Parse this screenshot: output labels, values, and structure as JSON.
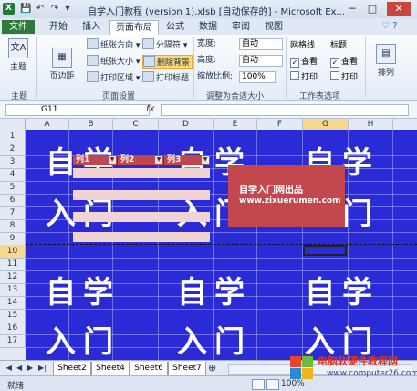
{
  "window": {
    "title": "自学入门教程 (version 1).xlsb [自动保存的] - Microsoft Ex...",
    "minimize": "─",
    "maximize": "□",
    "close": "✕"
  },
  "qat": {
    "save": "💾",
    "undo": "↶",
    "redo": "↷",
    "more": "▾"
  },
  "tabs": {
    "file": "文件",
    "items": [
      "开始",
      "插入",
      "页面布局",
      "公式",
      "数据",
      "审阅",
      "视图"
    ],
    "active_index": 2,
    "help": "♡ ?"
  },
  "ribbon": {
    "theme": {
      "icon": "文A",
      "label": "主题",
      "group": "主题"
    },
    "margins": {
      "label": "页边距"
    },
    "page_setup": {
      "orientation": "纸张方向 ▾",
      "size": "纸张大小 ▾",
      "print_area": "打印区域 ▾",
      "breaks": "分隔符 ▾",
      "delete_bg": "删除背景",
      "print_titles": "打印标题",
      "group": "页面设置"
    },
    "scale": {
      "width_label": "宽度:",
      "width_value": "自动",
      "height_label": "高度:",
      "height_value": "自动",
      "scale_label": "缩放比例:",
      "scale_value": "100%",
      "group": "调整为合适大小"
    },
    "sheet_options": {
      "gridlines": "网格线",
      "headings": "标题",
      "view": "查看",
      "print": "打印",
      "group": "工作表选项"
    },
    "arrange": {
      "label": "排列"
    }
  },
  "formula_bar": {
    "name_box": "G11",
    "fx": "fx",
    "content": ""
  },
  "columns": [
    "A",
    "B",
    "C",
    "D",
    "E",
    "F",
    "G",
    "H"
  ],
  "selected_column": "G",
  "rows": [
    "1",
    "2",
    "3",
    "4",
    "5",
    "6",
    "7",
    "8",
    "9",
    "10",
    "11",
    "12",
    "13",
    "14",
    "15",
    "16",
    "17"
  ],
  "selected_row": "11",
  "sheet": {
    "background_text": [
      "自学",
      "入门"
    ],
    "table_headers": [
      "列1",
      "列2",
      "列3"
    ],
    "promo_line1": "自学入门网出品",
    "promo_line2": "www.zixuerumen.com"
  },
  "sheet_tabs": [
    "Sheet2",
    "Sheet4",
    "Sheet6",
    "Sheet7"
  ],
  "status": {
    "text": "就绪",
    "zoom": "100%"
  },
  "watermark": {
    "line1": "电脑软硬件教程网",
    "line2": "www.computer26.com"
  }
}
